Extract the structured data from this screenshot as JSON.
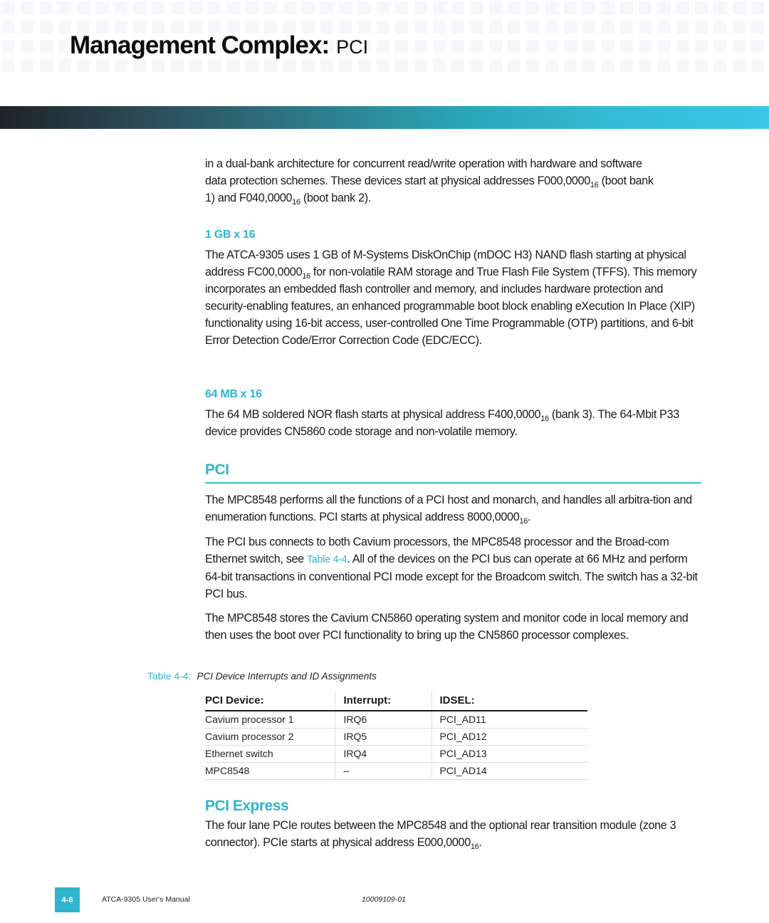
{
  "header": {
    "title_main": "Management Complex:",
    "title_sub": "PCI"
  },
  "intro": {
    "line1": "in a dual-bank architecture for concurrent read/write operation with hardware and software",
    "line2_pre": "data protection schemes. These devices start at physical addresses F000,0000",
    "line2_sub": "16",
    "line2_post": " (boot bank",
    "line3_pre": "1) and F040,0000",
    "line3_sub": "16",
    "line3_post": " (boot bank 2)."
  },
  "section_1gb": {
    "heading": "1 GB x 16",
    "text_pre": "The ATCA-9305 uses 1 GB of M-Systems DiskOnChip (mDOC H3) NAND flash starting at physical address FC00,0000",
    "text_sub": "16",
    "text_post": " for non-volatile RAM storage and True Flash File System (TFFS). This memory incorporates an embedded flash controller and memory, and includes hardware protection and security-enabling features, an enhanced programmable boot block enabling eXecution In Place (XIP) functionality using 16-bit access, user-controlled One Time Programmable (OTP) partitions, and 6-bit Error Detection Code/Error Correction Code (EDC/ECC)."
  },
  "section_64mb": {
    "heading": "64 MB x 16",
    "text_pre": "The 64 MB soldered NOR flash starts at physical address F400,0000",
    "text_sub": "16",
    "text_post": " (bank 3). The 64-Mbit P33 device provides CN5860 code storage and non-volatile memory."
  },
  "section_pci": {
    "heading": "PCI",
    "p1_pre": "The MPC8548 performs all the functions of a PCI host and monarch, and handles all arbitra-tion and enumeration functions. PCI starts at physical address 8000,0000",
    "p1_sub": "16",
    "p1_post": ".",
    "p2_pre": "The PCI bus connects to both Cavium processors, the MPC8548 processor and the Broad-com Ethernet switch, see ",
    "p2_link": "Table 4-4",
    "p2_post": ". All of the devices on the PCI bus can operate at 66 MHz and perform 64-bit transactions in conventional PCI mode except for the Broadcom switch. The switch has a 32-bit PCI bus.",
    "p3": "The MPC8548 stores the Cavium CN5860 operating system and monitor code in local memory and then uses the boot over PCI functionality to bring up the CN5860 processor complexes."
  },
  "table": {
    "caption_number": "Table 4-4:",
    "caption_title": "PCI Device Interrupts and ID Assignments",
    "headers": [
      "PCI Device:",
      "Interrupt:",
      "IDSEL:"
    ],
    "rows": [
      [
        "Cavium processor 1",
        "IRQ6",
        "PCI_AD11"
      ],
      [
        "Cavium processor 2",
        "IRQ5",
        "PCI_AD12"
      ],
      [
        "Ethernet switch",
        "IRQ4",
        "PCI_AD13"
      ],
      [
        "MPC8548",
        "–",
        "PCI_AD14"
      ]
    ]
  },
  "section_pcie": {
    "heading": "PCI Express",
    "text_pre": "The four lane PCIe routes between the MPC8548 and the optional rear transition module (zone 3 connector). PCIe starts at physical address E000,0000",
    "text_sub": "16",
    "text_post": "."
  },
  "footer": {
    "page_number": "4-8",
    "manual_title": "ATCA-9305 User's Manual",
    "doc_number": "10009109-01"
  },
  "colors": {
    "accent": "#2db6cc",
    "text": "#1a1a1a"
  }
}
